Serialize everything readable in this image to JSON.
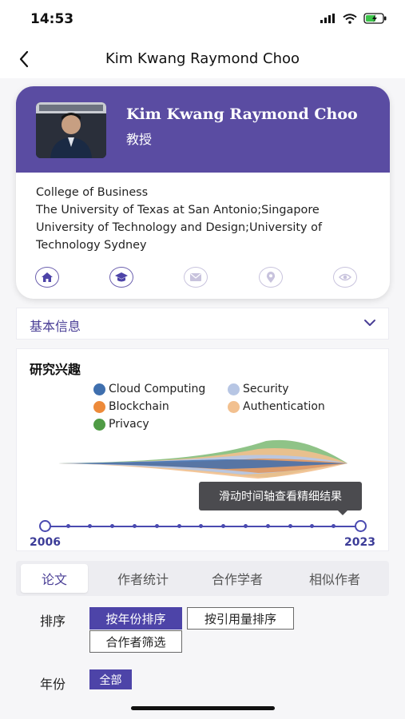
{
  "status_bar": {
    "time": "14:53"
  },
  "nav": {
    "title": "Kim Kwang Raymond Choo"
  },
  "profile": {
    "name": "Kim Kwang Raymond Choo",
    "role": "教授",
    "affiliation_lines": [
      "College of Business",
      "The University of Texas at San Antonio;Singapore",
      "University of Technology and Design;University of",
      "Technology Sydney"
    ],
    "action_icons": [
      "home-icon",
      "graduation-cap-icon",
      "mail-icon",
      "location-icon",
      "view-icon"
    ]
  },
  "basic_info": {
    "label": "基本信息"
  },
  "research_interest": {
    "title": "研究兴趣",
    "legend": [
      {
        "label": "Cloud Computing",
        "color": "#3f6fae"
      },
      {
        "label": "Security",
        "color": "#b7c6e4"
      },
      {
        "label": "Blockchain",
        "color": "#ed8a3a"
      },
      {
        "label": "Authentication",
        "color": "#f2c08f"
      },
      {
        "label": "Privacy",
        "color": "#4f9b45"
      }
    ],
    "tooltip": "滑动时间轴查看精细结果",
    "timeline": {
      "start": "2006",
      "end": "2023"
    }
  },
  "tabs": [
    {
      "label": "论文",
      "active": true
    },
    {
      "label": "作者统计",
      "active": false
    },
    {
      "label": "合作学者",
      "active": false
    },
    {
      "label": "相似作者",
      "active": false
    }
  ],
  "filters": {
    "sort_label": "排序",
    "sort_options": [
      "按年份排序",
      "按引用量排序",
      "合作者筛选"
    ],
    "year_label": "年份",
    "year_option": "全部"
  },
  "colors": {
    "accent": "#5a4ca2",
    "chip_active": "#4d44a8"
  }
}
